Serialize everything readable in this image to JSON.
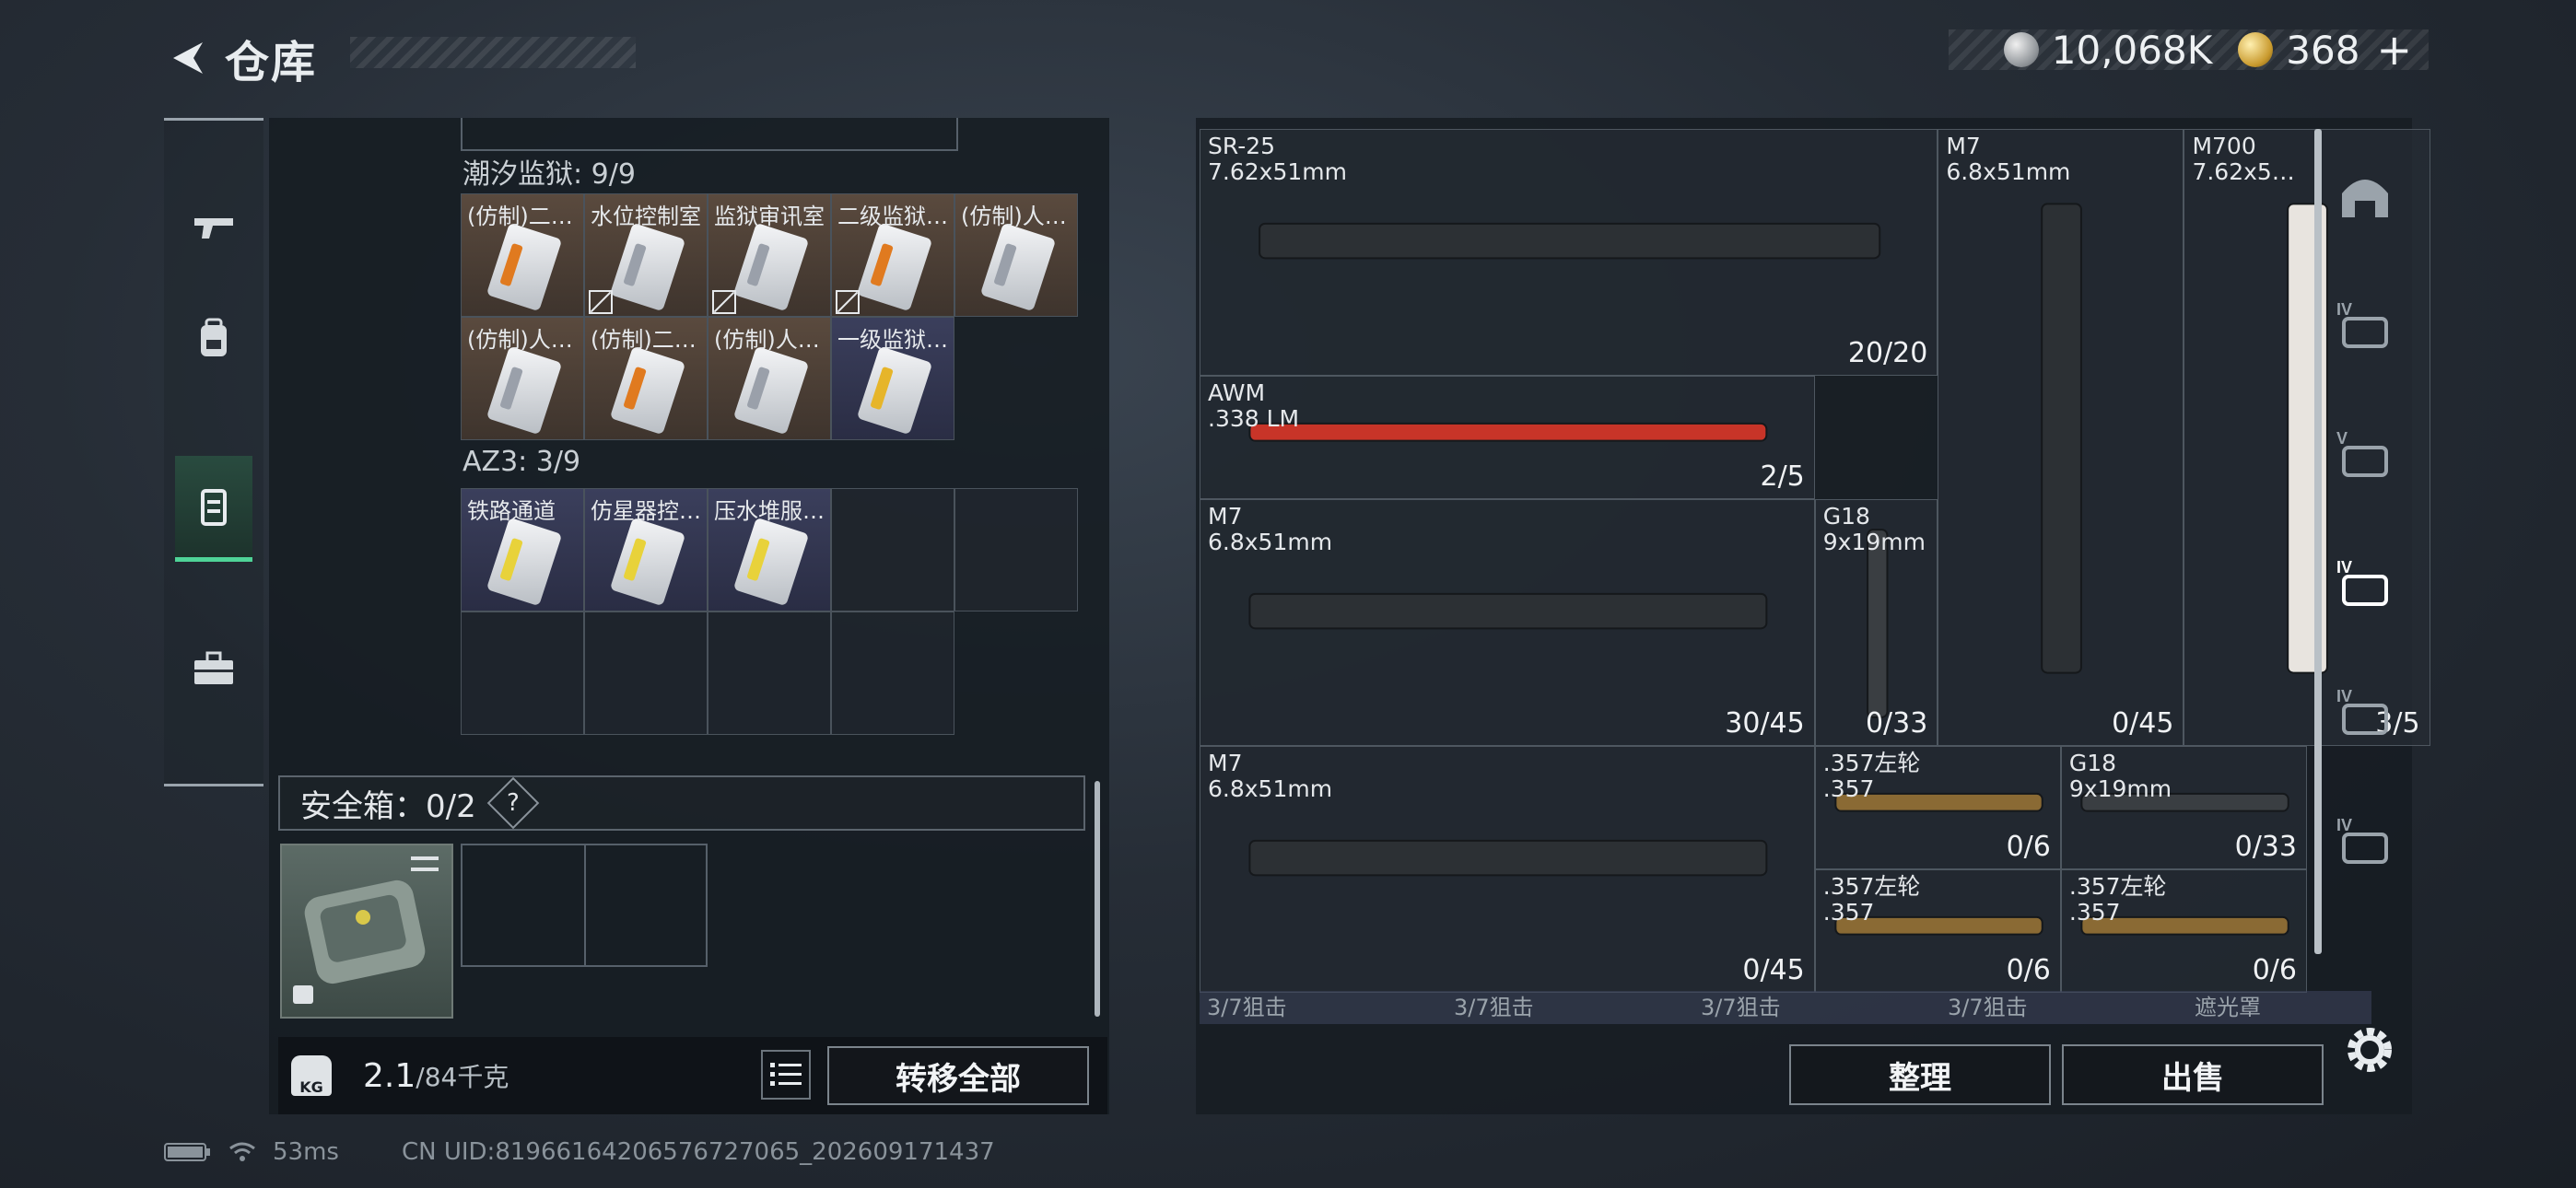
{
  "header": {
    "title": "仓库",
    "currency_silver": "10,068K",
    "currency_gold": "368",
    "plus": "+"
  },
  "left_nav": [
    "pistol-tab",
    "backpack-tab",
    "storage-tab",
    "toolbox-tab"
  ],
  "sections": {
    "prison": {
      "label": "潮汐监狱: 9/9",
      "items": [
        {
          "label": "(仿制)二…",
          "color": "brown",
          "stripe": "#e07a1f",
          "locked": false
        },
        {
          "label": "水位控制室",
          "color": "brown",
          "stripe": "#9aa0aa",
          "locked": true
        },
        {
          "label": "监狱审讯室",
          "color": "brown",
          "stripe": "#9aa0aa",
          "locked": true
        },
        {
          "label": "二级监狱…",
          "color": "brown",
          "stripe": "#e07a1f",
          "locked": true
        },
        {
          "label": "(仿制)人…",
          "color": "brown",
          "stripe": "#9aa0aa",
          "locked": false
        },
        {
          "label": "(仿制)人…",
          "color": "brown",
          "stripe": "#9aa0aa",
          "locked": false
        },
        {
          "label": "(仿制)二…",
          "color": "brown",
          "stripe": "#e07a1f",
          "locked": false
        },
        {
          "label": "(仿制)人…",
          "color": "brown",
          "stripe": "#9aa0aa",
          "locked": false
        },
        {
          "label": "一级监狱…",
          "color": "purple",
          "stripe": "#e6b52a",
          "locked": false
        }
      ]
    },
    "az3": {
      "label": "AZ3: 3/9",
      "items": [
        {
          "label": "铁路通道",
          "color": "purple",
          "stripe": "#e8d23a"
        },
        {
          "label": "仿星器控…",
          "color": "purple",
          "stripe": "#e8d23a"
        },
        {
          "label": "压水堆服…",
          "color": "purple",
          "stripe": "#e8d23a"
        }
      ]
    }
  },
  "safebox": {
    "label": "安全箱：0/2",
    "help": "?"
  },
  "weight": {
    "current": "2.1",
    "max": "/84千克",
    "kg_badge": "KG"
  },
  "buttons": {
    "transfer_all": "转移全部",
    "organize": "整理",
    "sell": "出售"
  },
  "weapons": [
    {
      "name": "SR-25\n7.62x51mm",
      "count": "20/20"
    },
    {
      "name": "M7\n6.8x51mm",
      "count": "0/45"
    },
    {
      "name": "M700\n7.62x5…",
      "count": "3/5"
    },
    {
      "name": "AWM\n.338 LM",
      "count": "2/5"
    },
    {
      "name": "M7\n6.8x51mm",
      "count": "30/45"
    },
    {
      "name": "G18\n9x19mm",
      "count": "0/33"
    },
    {
      "name": "M7\n6.8x51mm",
      "count": "0/45"
    },
    {
      "name": ".357左轮\n.357",
      "count": "0/6"
    },
    {
      "name": "G18\n9x19mm",
      "count": "0/33"
    },
    {
      "name": ".357左轮\n.357",
      "count": "0/6"
    },
    {
      "name": ".357左轮\n.357",
      "count": "0/6"
    }
  ],
  "bottom_labels": [
    "3/7狙击",
    "3/7狙击",
    "3/7狙击",
    "3/7狙击",
    "遮光罩"
  ],
  "right_nav_badges": [
    "IV",
    "V",
    "IV",
    "IV",
    "IV"
  ],
  "status": {
    "ping": "53ms",
    "uid": "CN UID:8196616420657672706​5_202609171437"
  }
}
